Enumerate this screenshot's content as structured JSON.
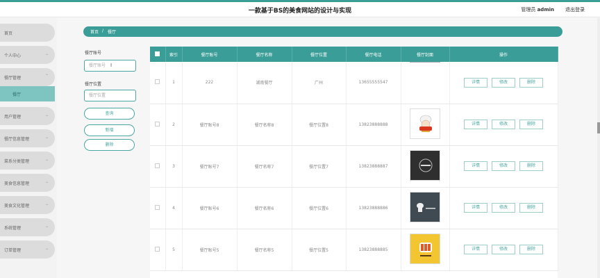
{
  "header": {
    "title": "一款基于BS的美食网站的设计与实现",
    "user_prefix": "管理员",
    "user_name": "admin",
    "logout": "退出登录"
  },
  "sidebar": {
    "items": [
      {
        "label": "首页"
      },
      {
        "label": "个人中心"
      },
      {
        "label": "餐厅管理"
      },
      {
        "label": "用户管理"
      },
      {
        "label": "餐厅信息管理"
      },
      {
        "label": "菜系分类管理"
      },
      {
        "label": "美食信息管理"
      },
      {
        "label": "美食文化管理"
      },
      {
        "label": "系统管理"
      },
      {
        "label": "订单管理"
      }
    ],
    "active_sub": "餐厅"
  },
  "breadcrumb": {
    "home": "首页",
    "sep": "/",
    "current": "餐厅"
  },
  "search": {
    "account_label": "餐厅账号",
    "account_placeholder": "餐厅账号",
    "location_label": "餐厅位置",
    "location_placeholder": "餐厅位置",
    "query_btn": "查询",
    "add_btn": "新增",
    "delete_btn": "删除"
  },
  "table": {
    "headers": [
      "索引",
      "餐厅账号",
      "餐厅名称",
      "餐厅位置",
      "餐厅电话",
      "餐厅封面",
      "操作"
    ],
    "actions": {
      "detail": "详情",
      "edit": "修改",
      "delete": "删除"
    },
    "rows": [
      {
        "idx": "1",
        "account": "222",
        "name": "湖南餐厅",
        "location": "广州",
        "phone": "13655555547"
      },
      {
        "idx": "2",
        "account": "餐厅账号8",
        "name": "餐厅名称8",
        "location": "餐厅位置8",
        "phone": "13823888888"
      },
      {
        "idx": "3",
        "account": "餐厅账号7",
        "name": "餐厅名称7",
        "location": "餐厅位置7",
        "phone": "13823888887"
      },
      {
        "idx": "4",
        "account": "餐厅账号6",
        "name": "餐厅名称6",
        "location": "餐厅位置6",
        "phone": "13823888886"
      },
      {
        "idx": "5",
        "account": "餐厅账号5",
        "name": "餐厅名称5",
        "location": "餐厅位置5",
        "phone": "13823888885"
      }
    ]
  }
}
